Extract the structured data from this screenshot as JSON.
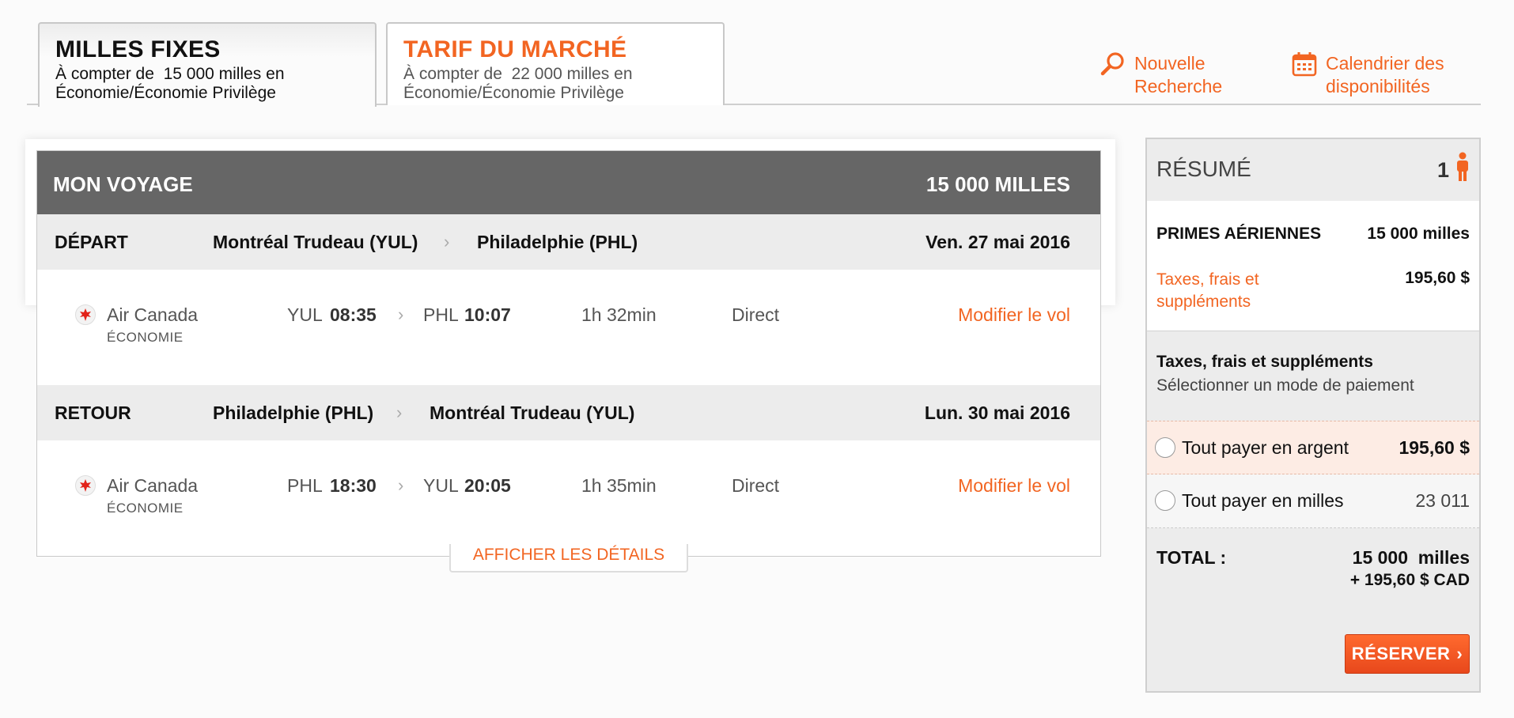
{
  "tabs": [
    {
      "title": "MILLES FIXES",
      "prefix": "À compter de",
      "amount": "15 000 milles en",
      "cabin": "Économie/Économie Privilège",
      "active": true
    },
    {
      "title": "TARIF DU MARCHÉ",
      "prefix": "À compter de",
      "amount": "22 000 milles en",
      "cabin": "Économie/Économie Privilège",
      "active": false
    }
  ],
  "links": {
    "new_search": {
      "line1": "Nouvelle",
      "line2": "Recherche",
      "icon": "search-icon"
    },
    "calendar": {
      "line1": "Calendrier des",
      "line2": "disponibilités",
      "icon": "calendar-icon"
    }
  },
  "trip": {
    "title": "MON VOYAGE",
    "total": "15 000 MILLES",
    "segments": [
      {
        "label": "DÉPART",
        "from": "Montréal Trudeau (YUL)",
        "to": "Philadelphie (PHL)",
        "date": "Ven. 27 mai 2016",
        "airline": "Air Canada",
        "cabin": "ÉCONOMIE",
        "dep_code": "YUL",
        "dep_time": "08:35",
        "arr_code": "PHL",
        "arr_time": "10:07",
        "duration": "1h 32min",
        "stops": "Direct",
        "modify": "Modifier le vol"
      },
      {
        "label": "RETOUR",
        "from": "Philadelphie (PHL)",
        "to": "Montréal Trudeau (YUL)",
        "date": "Lun. 30 mai 2016",
        "airline": "Air Canada",
        "cabin": "ÉCONOMIE",
        "dep_code": "PHL",
        "dep_time": "18:30",
        "arr_code": "YUL",
        "arr_time": "20:05",
        "duration": "1h 35min",
        "stops": "Direct",
        "modify": "Modifier le vol"
      }
    ],
    "details_label": "AFFICHER LES DÉTAILS"
  },
  "summary": {
    "title": "RÉSUMÉ",
    "passengers": "1",
    "awards_label": "PRIMES AÉRIENNES",
    "awards_value": "15 000 milles",
    "taxes_label_1": "Taxes, frais et",
    "taxes_label_2": "suppléments",
    "taxes_value": "195,60 $",
    "pay_title": "Taxes, frais et suppléments",
    "pay_subtitle": "Sélectionner un mode de paiement",
    "options": [
      {
        "label": "Tout payer en argent",
        "value": "195,60 $",
        "selected": true
      },
      {
        "label": "Tout payer en milles",
        "value": "23 011",
        "selected": false
      }
    ],
    "total_label": "TOTAL :",
    "total_miles": "15 000  milles",
    "total_cash": "+ 195,60 $ CAD",
    "reserve_label": "RÉSERVER"
  },
  "colors": {
    "accent": "#f26522",
    "header_bg": "#666666",
    "row_bg": "#ececec"
  }
}
